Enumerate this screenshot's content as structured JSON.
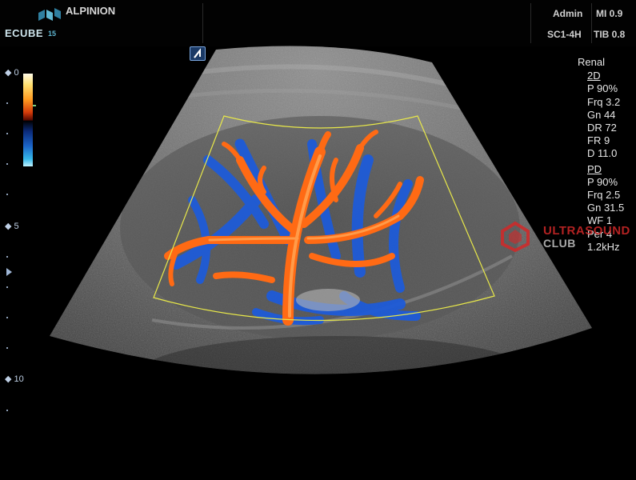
{
  "header": {
    "brand": "ALPINION",
    "logo_text": "ECUBE",
    "logo_model": "15",
    "user": "Admin",
    "probe": "SC1-4H",
    "mi": "MI 0.9",
    "tib": "TIB 0.8"
  },
  "depth_scale": {
    "labels": [
      "0",
      "5",
      "10"
    ]
  },
  "colormap": {
    "top_color": "#fffbe8",
    "bottom_color": "#bff3ff",
    "mid_color": "#000000"
  },
  "params": {
    "preset": "Renal",
    "mode_2d_title": "2D",
    "mode_2d": [
      "P 90%",
      "Frq 3.2",
      "Gn 44",
      "DR 72",
      "FR 9",
      "D 11.0"
    ],
    "mode_pd_title": "PD",
    "mode_pd": [
      "P 90%",
      "Frq 2.5",
      "Gn 31.5",
      "WF 1",
      "Per 4",
      "1.2kHz"
    ]
  },
  "watermark": {
    "line1": "ULTRASOUND",
    "line2": "CLUB"
  },
  "colors": {
    "roi_box": "#e8e84a",
    "doppler_red": "#ff6a14",
    "doppler_blue": "#1e5bd8",
    "accent": "#5fb7d2"
  }
}
